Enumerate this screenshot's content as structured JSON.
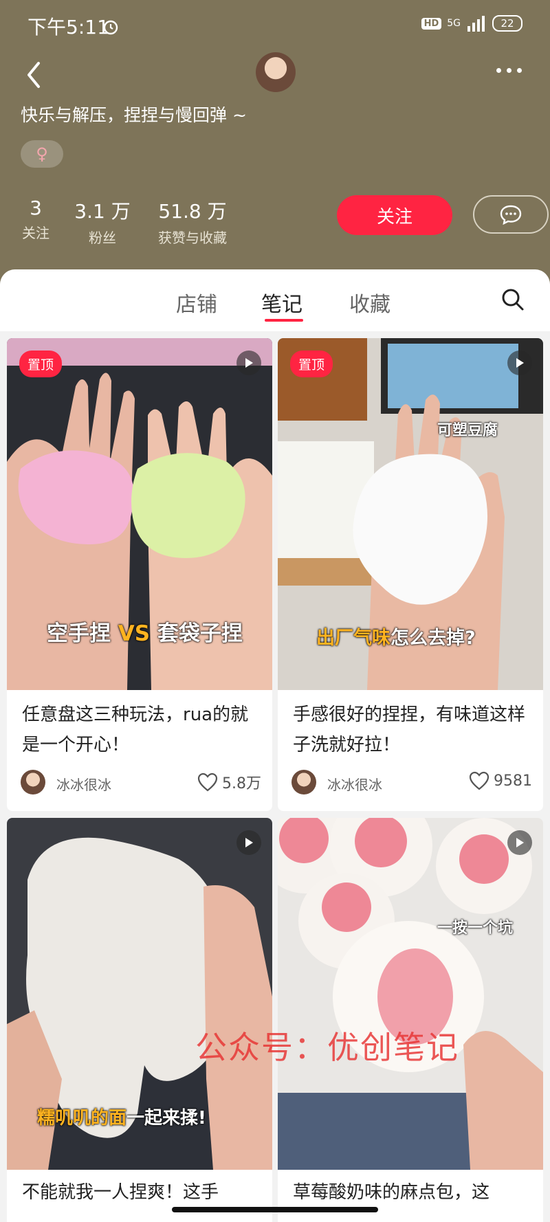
{
  "status_bar": {
    "time": "下午5:11",
    "hd": "HD",
    "network": "5G",
    "battery": "22"
  },
  "profile": {
    "bio": "快乐与解压，捏捏与慢回弹 ~",
    "gender_symbol": "♀",
    "stats": [
      {
        "value": "3",
        "label": "关注"
      },
      {
        "value": "3.1 万",
        "label": "粉丝"
      },
      {
        "value": "51.8 万",
        "label": "获赞与收藏"
      }
    ],
    "follow_label": "关注"
  },
  "tabs": {
    "items": [
      "店铺",
      "笔记",
      "收藏"
    ],
    "active": "笔记"
  },
  "notes": [
    {
      "pinned": "置顶",
      "overlay_a": "空手捏 ",
      "overlay_vs": "VS",
      "overlay_b": " 套袋子捏",
      "title": "任意盘这三种玩法，rua的就是一个开心！",
      "author": "冰冰很冰",
      "likes": "5.8万"
    },
    {
      "pinned": "置顶",
      "overlay_top": "可塑豆腐",
      "overlay_a": "出厂气味",
      "overlay_b": "怎么去掉?",
      "title": "手感很好的捏捏，有味道这样子洗就好拉！",
      "author": "冰冰很冰",
      "likes": "9581"
    },
    {
      "overlay_a": "糯叽叽的面",
      "overlay_b": "一起来揉!",
      "title": "不能就我一人捏爽！这手"
    },
    {
      "overlay_top": "一按一个坑",
      "title": "草莓酸奶味的麻点包，这"
    }
  ],
  "watermark": "公众号：优创笔记",
  "colors": {
    "header_bg": "#7e7459",
    "accent": "#ff2442"
  }
}
